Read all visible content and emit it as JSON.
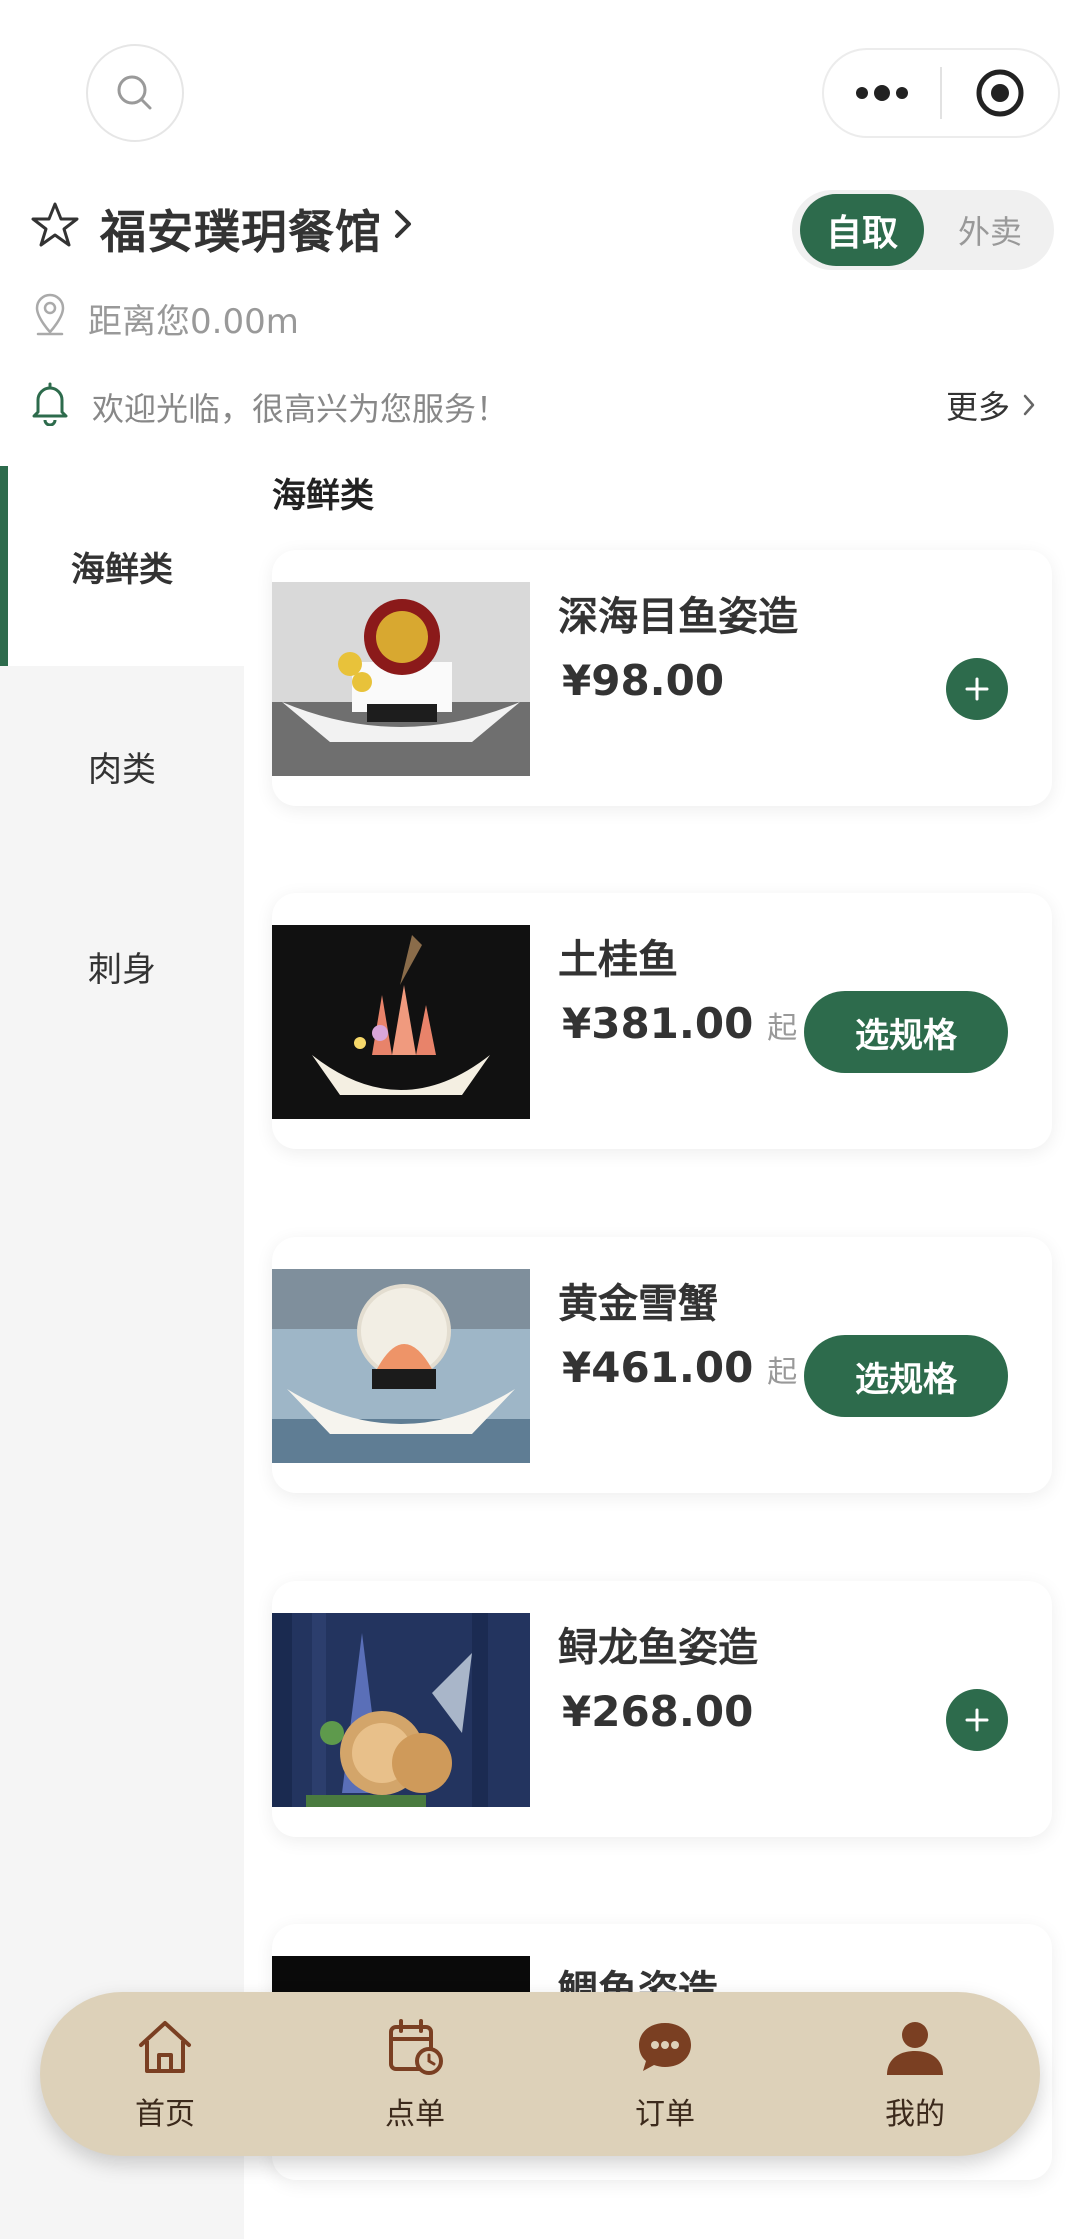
{
  "nav": {
    "search_icon": "search-icon",
    "more_icon": "more-dots-icon",
    "close_icon": "target-circle-icon"
  },
  "store": {
    "name": "福安璞玥餐馆",
    "mode_active": "自取",
    "mode_inactive": "外卖",
    "distance": "距离您0.00m",
    "notice": "欢迎光临，很高兴为您服务！",
    "more": "更多"
  },
  "categories": [
    {
      "label": "海鲜类",
      "active": true
    },
    {
      "label": "肉类",
      "active": false
    },
    {
      "label": "刺身",
      "active": false
    }
  ],
  "section_title": "海鲜类",
  "dishes": [
    {
      "name": "深海目鱼姿造",
      "price": "¥98.00",
      "suffix": "",
      "action": "add"
    },
    {
      "name": "土桂鱼",
      "price": "¥381.00",
      "suffix": "起",
      "action": "spec",
      "action_label": "选规格"
    },
    {
      "name": "黄金雪蟹",
      "price": "¥461.00",
      "suffix": "起",
      "action": "spec",
      "action_label": "选规格"
    },
    {
      "name": "鲟龙鱼姿造",
      "price": "¥268.00",
      "suffix": "",
      "action": "add"
    },
    {
      "name": "鲷鱼姿造",
      "price": "",
      "suffix": "",
      "action": "none"
    }
  ],
  "tabbar": [
    {
      "label": "首页",
      "icon": "home-icon"
    },
    {
      "label": "点单",
      "icon": "calendar-clock-icon"
    },
    {
      "label": "订单",
      "icon": "chat-bubble-icon"
    },
    {
      "label": "我的",
      "icon": "user-icon"
    }
  ],
  "colors": {
    "brand_green": "#2d6b4c",
    "tabbar_bg": "#ddd1b9",
    "tab_icon": "#7a3f22"
  }
}
